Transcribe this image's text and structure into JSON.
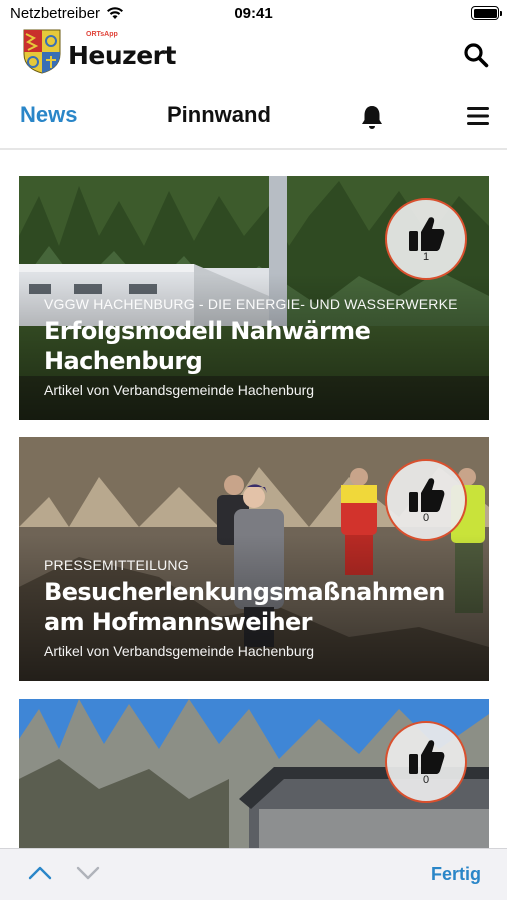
{
  "status_bar": {
    "carrier": "Netzbetreiber",
    "time": "09:41"
  },
  "header": {
    "app_brand_prefix": "ORTs",
    "app_brand_suffix": "App",
    "app_name": "Heuzert",
    "icons": [
      "crest-logo",
      "search-icon"
    ]
  },
  "tabs": {
    "news": "News",
    "pinnwand": "Pinnwand",
    "icons": [
      "bell-icon",
      "menu-icon"
    ]
  },
  "articles": [
    {
      "category": "VGGW Hachenburg - Die Energie- und Wasserwerke",
      "title": "Erfolgsmodell Nahwärme Hachenburg",
      "author": "Artikel von Verbandsgemeinde Hachenburg",
      "likes": "1"
    },
    {
      "category": "Pressemitteilung",
      "title": "Besucherlenkungsmaßnahmen am Hofmannsweiher",
      "author": "Artikel von Verbandsgemeinde Hachenburg",
      "likes": "0"
    },
    {
      "category": "",
      "title": "",
      "author": "",
      "likes": "0"
    }
  ],
  "toolbar": {
    "done_label": "Fertig",
    "icons": [
      "chevron-up-icon",
      "chevron-down-icon"
    ]
  },
  "colors": {
    "accent": "#2a86c8",
    "badge_border": "#d9502e",
    "toolbar_bg": "#f2f2f5"
  }
}
